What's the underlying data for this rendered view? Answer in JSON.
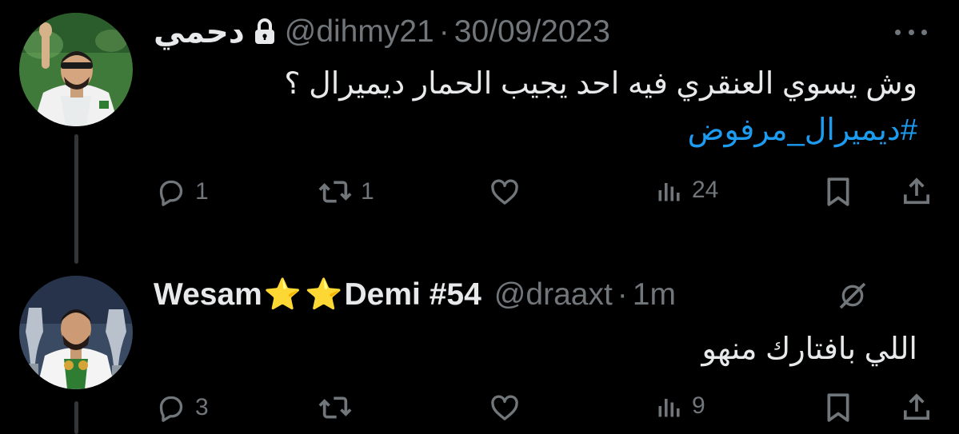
{
  "tweets": [
    {
      "author_name": "دحمي",
      "handle": "@dihmy21",
      "separator": "·",
      "time": "30/09/2023",
      "text_main": "وش يسوي العنقري فيه احد يجيب الحمار ديميرال ؟",
      "hashtag": "#ديميرال_مرفوض",
      "reply_count": "1",
      "retweet_count": "1",
      "view_count": "24",
      "icons": [
        "lock-icon",
        "more-icon",
        "reply-icon",
        "retweet-icon",
        "like-icon",
        "views-icon",
        "bookmark-icon",
        "share-icon"
      ]
    },
    {
      "author_name_part1": "Wesam",
      "stars": [
        "⭐",
        "⭐"
      ],
      "author_name_part2": "Demi #54",
      "handle": "@draaxt",
      "separator": "·",
      "time": "1m",
      "text_main": "اللي بافتارك منهو",
      "reply_count": "3",
      "view_count": "9",
      "icons": [
        "grok-icon",
        "reply-icon",
        "retweet-icon",
        "like-icon",
        "views-icon",
        "bookmark-icon",
        "share-icon"
      ]
    }
  ],
  "colors": {
    "background": "#000000",
    "text": "#e7e9ea",
    "muted": "#71767b",
    "link": "#1d9bf0",
    "thread_line": "#333639"
  }
}
